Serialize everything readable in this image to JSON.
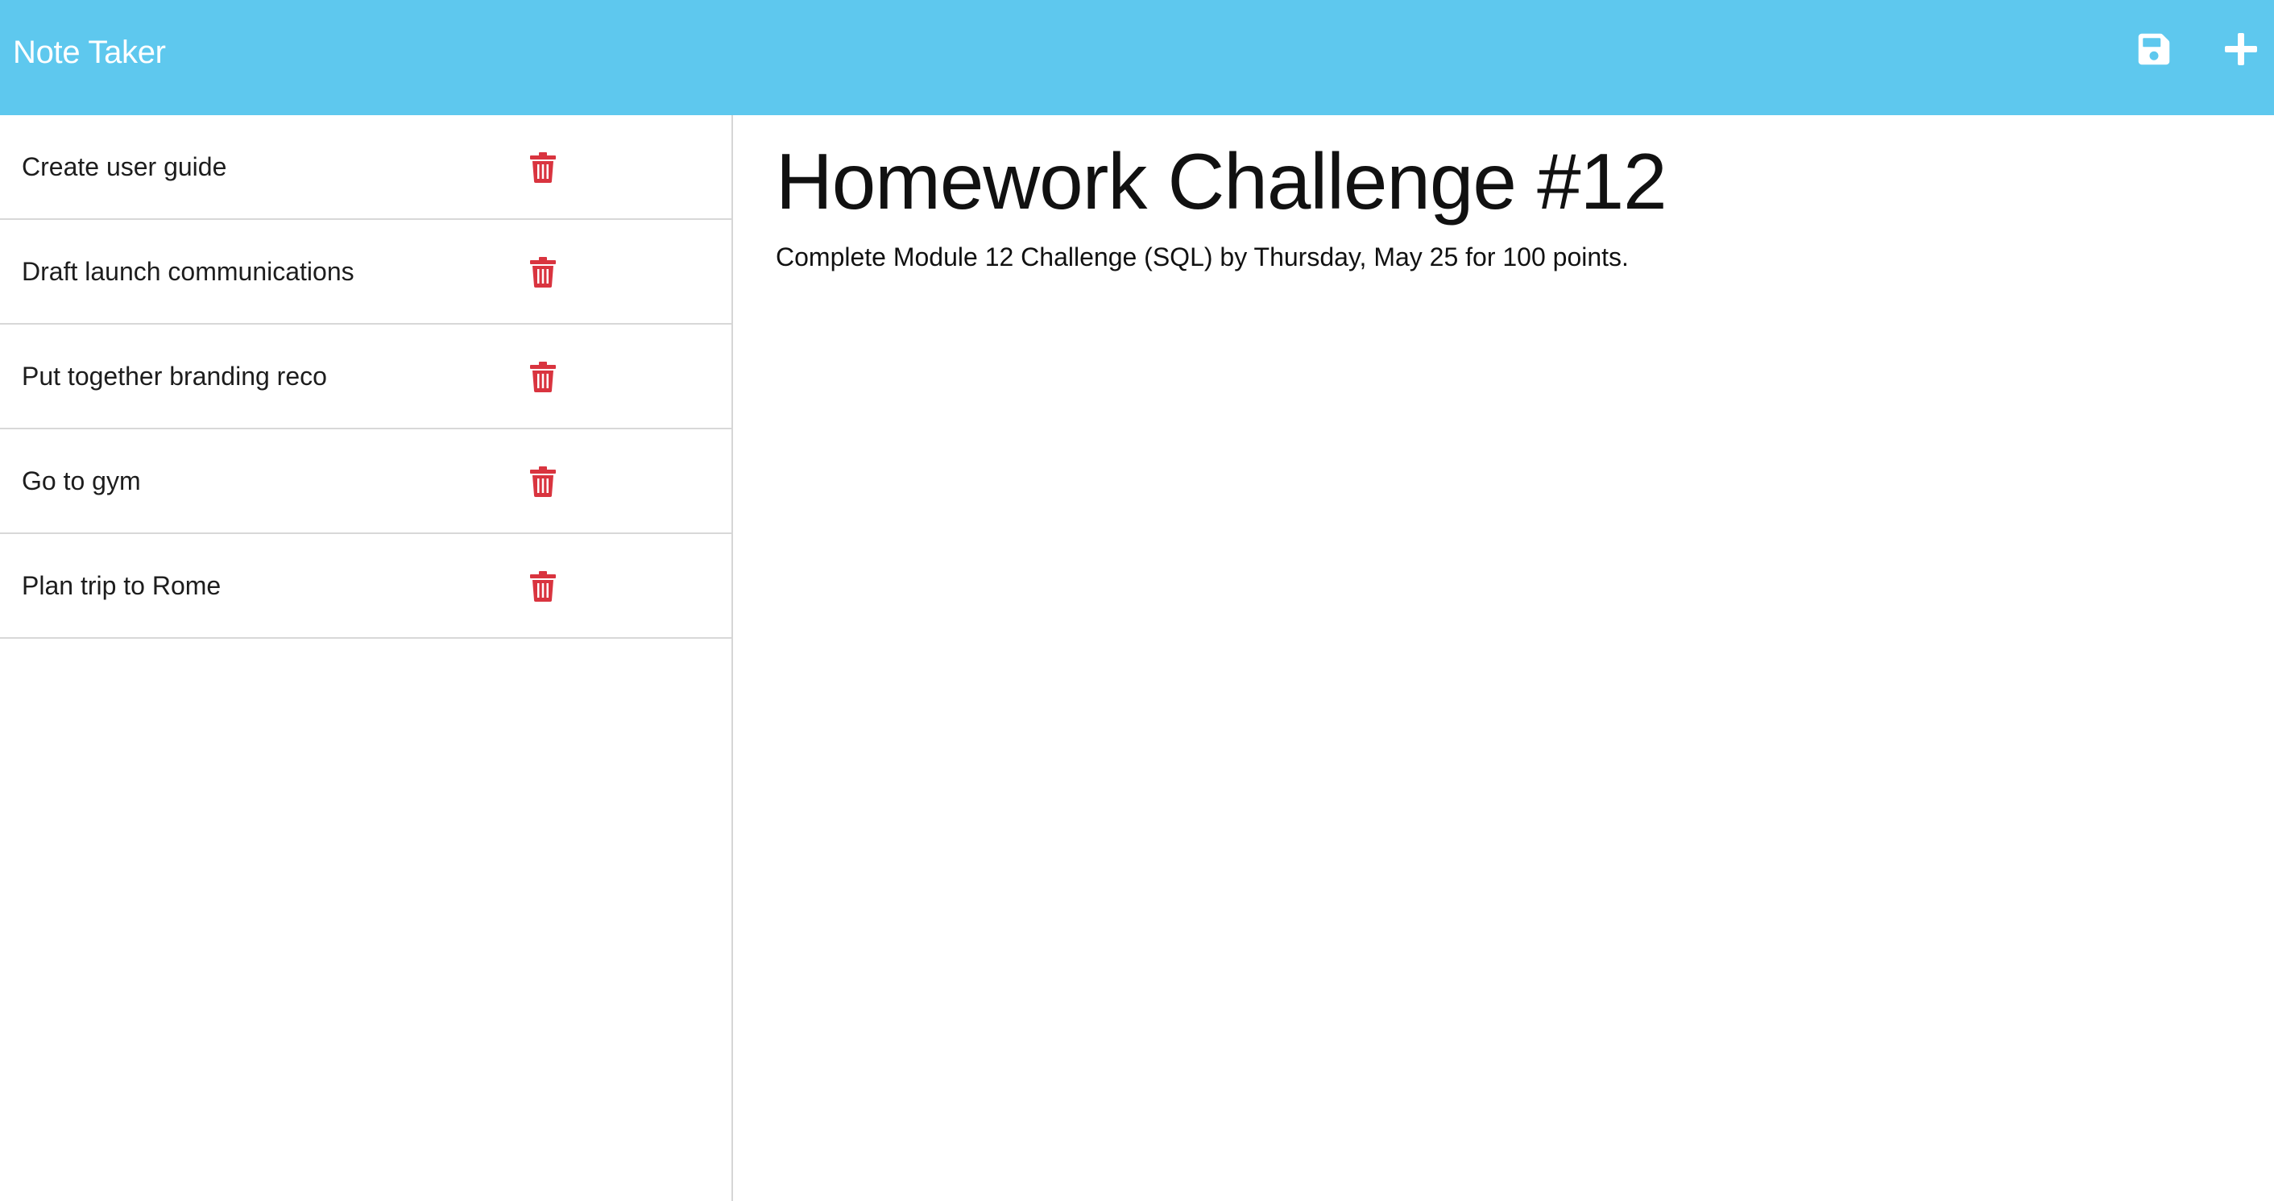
{
  "app": {
    "title": "Note Taker",
    "accent_color": "#5ec8ee",
    "delete_color": "#d9343f"
  },
  "toolbar": {
    "save_icon": "floppy-disk-icon",
    "add_icon": "plus-icon"
  },
  "notes": [
    {
      "title": "Create user guide",
      "delete_icon": "trash-icon"
    },
    {
      "title": "Draft launch communications",
      "delete_icon": "trash-icon"
    },
    {
      "title": "Put together branding reco",
      "delete_icon": "trash-icon"
    },
    {
      "title": "Go to gym",
      "delete_icon": "trash-icon"
    },
    {
      "title": "Plan trip to Rome",
      "delete_icon": "trash-icon"
    }
  ],
  "active_note": {
    "title": "Homework Challenge #12",
    "text": "Complete Module 12 Challenge (SQL) by Thursday, May 25 for 100 points."
  }
}
